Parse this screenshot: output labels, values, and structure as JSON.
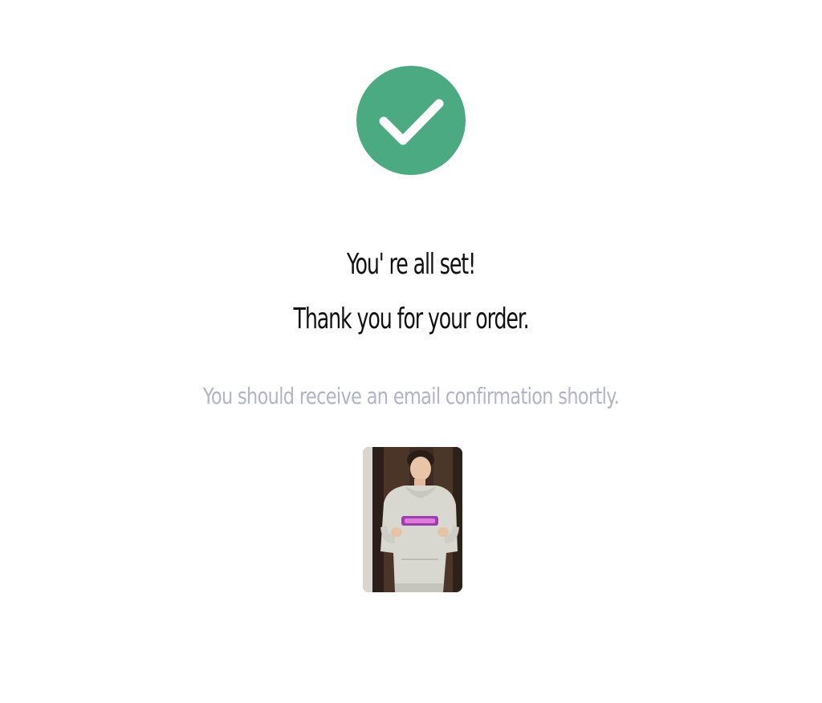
{
  "confirmation": {
    "icon": "check-circle-icon",
    "icon_color": "#4caa82",
    "title_line_1": "You' re all set!",
    "title_line_2": "Thank you for your order.",
    "message": "You should receive an email confirmation shortly.",
    "message_color": "#b1b3c7"
  },
  "product": {
    "image": "product-photo"
  }
}
